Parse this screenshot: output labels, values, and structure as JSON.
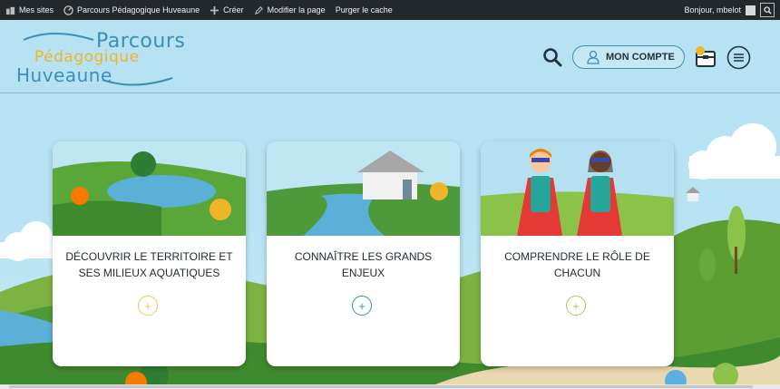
{
  "adminbar": {
    "items": [
      {
        "icon": "sites-icon",
        "label": "Mes sites"
      },
      {
        "icon": "dashboard-icon",
        "label": "Parcours Pédagogique Huveaune"
      },
      {
        "icon": "plus-icon",
        "label": "Créer"
      },
      {
        "icon": "pencil-icon",
        "label": "Modifier la page"
      },
      {
        "icon": "",
        "label": "Purger le cache"
      }
    ],
    "greeting": "Bonjour, mbelot"
  },
  "logo": {
    "line1": "Parcours",
    "line2": "Pédagogique",
    "line3": "Huveaune"
  },
  "header": {
    "account_label": "MON COMPTE",
    "bag_badge": "1"
  },
  "cards": [
    {
      "title": "DÉCOUVRIR LE TERRITOIRE ET SES MILIEUX AQUATIQUES",
      "plus": "+",
      "accent": "#f2c94c"
    },
    {
      "title": "CONNAÎTRE LES GRANDS ENJEUX",
      "plus": "+",
      "accent": "#3b8fb5"
    },
    {
      "title": "COMPRENDRE LE RÔLE DE CHACUN",
      "plus": "+",
      "accent": "#a7c957"
    }
  ],
  "colors": {
    "primary": "#3b8fb5",
    "accent": "#f0b429",
    "sky": "#b6e2f3",
    "grass": "#4e9a3a"
  }
}
